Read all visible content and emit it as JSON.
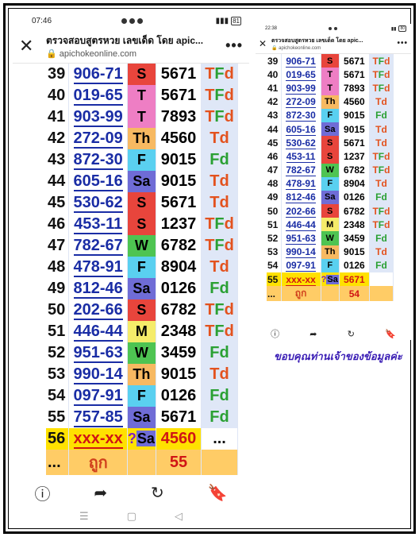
{
  "left_screen": {
    "status": {
      "time": "07:46",
      "battery": "81"
    },
    "browser": {
      "close_icon": "close-icon",
      "title": "ตรวจสอบสูตรหวย เลขเด็ด โดย apic...",
      "domain": "apichokeonline.com",
      "menu_icon": "more-vert-icon"
    },
    "rows": [
      {
        "n": "39",
        "pair": "906-71",
        "day": "S",
        "day_color": "#e8453c",
        "digits": "5671",
        "tf": "TFd"
      },
      {
        "n": "40",
        "pair": "019-65",
        "day": "T",
        "day_color": "#ee7ec4",
        "digits": "5671",
        "tf": "TFd"
      },
      {
        "n": "41",
        "pair": "903-99",
        "day": "T",
        "day_color": "#ee7ec4",
        "digits": "7893",
        "tf": "TFd"
      },
      {
        "n": "42",
        "pair": "272-09",
        "day": "Th",
        "day_color": "#f7b961",
        "digits": "4560",
        "tf": "Td"
      },
      {
        "n": "43",
        "pair": "872-30",
        "day": "F",
        "day_color": "#5ad0f0",
        "digits": "9015",
        "tf": "Fd"
      },
      {
        "n": "44",
        "pair": "605-16",
        "day": "Sa",
        "day_color": "#6f6cd6",
        "digits": "9015",
        "tf": "Td"
      },
      {
        "n": "45",
        "pair": "530-62",
        "day": "S",
        "day_color": "#e8453c",
        "digits": "5671",
        "tf": "Td"
      },
      {
        "n": "46",
        "pair": "453-11",
        "day": "S",
        "day_color": "#e8453c",
        "digits": "1237",
        "tf": "TFd"
      },
      {
        "n": "47",
        "pair": "782-67",
        "day": "W",
        "day_color": "#4ec452",
        "digits": "6782",
        "tf": "TFd"
      },
      {
        "n": "48",
        "pair": "478-91",
        "day": "F",
        "day_color": "#5ad0f0",
        "digits": "8904",
        "tf": "Td"
      },
      {
        "n": "49",
        "pair": "812-46",
        "day": "Sa",
        "day_color": "#6f6cd6",
        "digits": "0126",
        "tf": "Fd"
      },
      {
        "n": "50",
        "pair": "202-66",
        "day": "S",
        "day_color": "#e8453c",
        "digits": "6782",
        "tf": "TFd"
      },
      {
        "n": "51",
        "pair": "446-44",
        "day": "M",
        "day_color": "#f5ec6a",
        "digits": "2348",
        "tf": "TFd"
      },
      {
        "n": "52",
        "pair": "951-63",
        "day": "W",
        "day_color": "#4ec452",
        "digits": "3459",
        "tf": "Fd"
      },
      {
        "n": "53",
        "pair": "990-14",
        "day": "Th",
        "day_color": "#f7b961",
        "digits": "9015",
        "tf": "Td"
      },
      {
        "n": "54",
        "pair": "097-91",
        "day": "F",
        "day_color": "#5ad0f0",
        "digits": "0126",
        "tf": "Fd"
      },
      {
        "n": "55",
        "pair": "757-85",
        "day": "Sa",
        "day_color": "#6f6cd6",
        "digits": "5671",
        "tf": "Fd"
      }
    ],
    "guess": {
      "n": "56",
      "pair": "xxx-xx",
      "qmark": "?",
      "day": "Sa",
      "digits": "4560",
      "tf": "..."
    },
    "result": {
      "n": "...",
      "label": "ถูก",
      "count": "55"
    }
  },
  "right_screen": {
    "status": {
      "time": "22:38",
      "battery": "80"
    },
    "browser": {
      "title": "ตรวจสอบสูตรหวย เลขเด็ด โดย apic...",
      "domain": "apichokeonline.com"
    },
    "rows": [
      {
        "n": "39",
        "pair": "906-71",
        "day": "S",
        "day_color": "#e8453c",
        "digits": "5671",
        "tf": "TFd"
      },
      {
        "n": "40",
        "pair": "019-65",
        "day": "T",
        "day_color": "#ee7ec4",
        "digits": "5671",
        "tf": "TFd"
      },
      {
        "n": "41",
        "pair": "903-99",
        "day": "T",
        "day_color": "#ee7ec4",
        "digits": "7893",
        "tf": "TFd"
      },
      {
        "n": "42",
        "pair": "272-09",
        "day": "Th",
        "day_color": "#f7b961",
        "digits": "4560",
        "tf": "Td"
      },
      {
        "n": "43",
        "pair": "872-30",
        "day": "F",
        "day_color": "#5ad0f0",
        "digits": "9015",
        "tf": "Fd"
      },
      {
        "n": "44",
        "pair": "605-16",
        "day": "Sa",
        "day_color": "#6f6cd6",
        "digits": "9015",
        "tf": "Td"
      },
      {
        "n": "45",
        "pair": "530-62",
        "day": "S",
        "day_color": "#e8453c",
        "digits": "5671",
        "tf": "Td"
      },
      {
        "n": "46",
        "pair": "453-11",
        "day": "S",
        "day_color": "#e8453c",
        "digits": "1237",
        "tf": "TFd"
      },
      {
        "n": "47",
        "pair": "782-67",
        "day": "W",
        "day_color": "#4ec452",
        "digits": "6782",
        "tf": "TFd"
      },
      {
        "n": "48",
        "pair": "478-91",
        "day": "F",
        "day_color": "#5ad0f0",
        "digits": "8904",
        "tf": "Td"
      },
      {
        "n": "49",
        "pair": "812-46",
        "day": "Sa",
        "day_color": "#6f6cd6",
        "digits": "0126",
        "tf": "Fd"
      },
      {
        "n": "50",
        "pair": "202-66",
        "day": "S",
        "day_color": "#e8453c",
        "digits": "6782",
        "tf": "TFd"
      },
      {
        "n": "51",
        "pair": "446-44",
        "day": "M",
        "day_color": "#f5ec6a",
        "digits": "2348",
        "tf": "TFd"
      },
      {
        "n": "52",
        "pair": "951-63",
        "day": "W",
        "day_color": "#4ec452",
        "digits": "3459",
        "tf": "Fd"
      },
      {
        "n": "53",
        "pair": "990-14",
        "day": "Th",
        "day_color": "#f7b961",
        "digits": "9015",
        "tf": "Td"
      },
      {
        "n": "54",
        "pair": "097-91",
        "day": "F",
        "day_color": "#5ad0f0",
        "digits": "0126",
        "tf": "Fd"
      }
    ],
    "guess": {
      "n": "55",
      "pair": "xxx-xx",
      "qmark": "?",
      "day": "Sa",
      "digits": "5671",
      "tf": ""
    },
    "result": {
      "n": "...",
      "label": "ถูก",
      "count": "54"
    }
  },
  "thanks_text": "ขอบคุณท่านเจ้าของข้อมูลค่ะ",
  "nav_icons": [
    "info-icon",
    "share-icon",
    "refresh-icon",
    "bookmark-icon"
  ],
  "colors": {
    "tf_T": "#e3521e",
    "tf_F": "#2aa033",
    "pair": "#1a2da5",
    "guess_bg": "#ffe100",
    "result_bg": "#ffcc66"
  }
}
